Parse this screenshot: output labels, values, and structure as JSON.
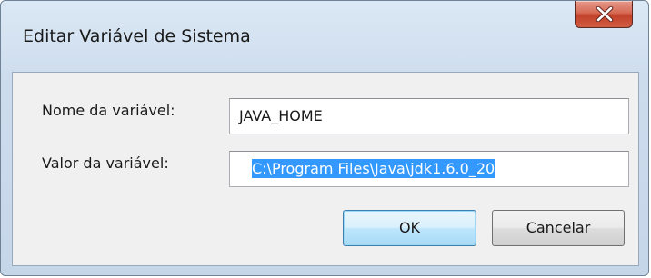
{
  "window": {
    "title": "Editar Variável de Sistema"
  },
  "form": {
    "name_label": "Nome da variável:",
    "name_value": "JAVA_HOME",
    "value_label": "Valor da variável:",
    "value_value": "C:\\Program Files\\Java\\jdk1.6.0_20"
  },
  "buttons": {
    "ok_label": "OK",
    "cancel_label": "Cancelar"
  },
  "icons": {
    "close": "close-icon"
  },
  "colors": {
    "close_button": "#c24129",
    "selection": "#3399ff",
    "default_button_border": "#3c7fb1"
  }
}
